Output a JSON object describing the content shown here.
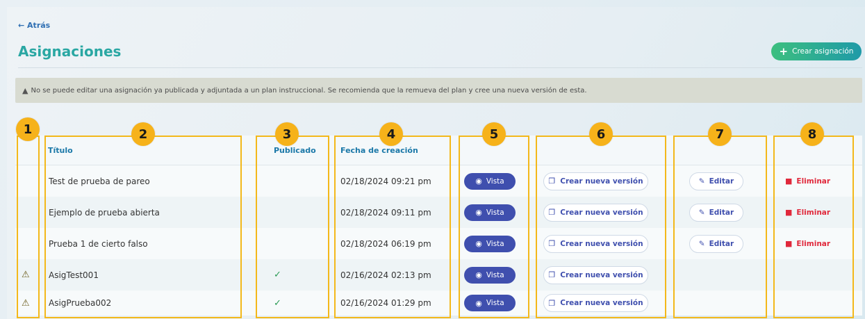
{
  "nav": {
    "back_label": "← Atrás"
  },
  "header": {
    "title": "Asignaciones",
    "create_button_label": "Crear asignación"
  },
  "notice": {
    "icon": "warning-icon",
    "text": "No se puede editar una asignación ya publicada y adjuntada a un plan instruccional. Se recomienda que la remueva del plan y cree una nueva versión de esta."
  },
  "table": {
    "columns": {
      "title": "Título",
      "published": "Publicado",
      "created": "Fecha de creación"
    },
    "rows": [
      {
        "warning": "",
        "title": "Test de prueba de pareo",
        "published": "",
        "created": "02/18/2024 09:21 pm",
        "view": "Vista",
        "new_version": "Crear nueva versión",
        "edit": "Editar",
        "delete": "Eliminar"
      },
      {
        "warning": "",
        "title": "Ejemplo de prueba abierta",
        "published": "",
        "created": "02/18/2024 09:11 pm",
        "view": "Vista",
        "new_version": "Crear nueva versión",
        "edit": "Editar",
        "delete": "Eliminar"
      },
      {
        "warning": "",
        "title": "Prueba 1 de cierto falso",
        "published": "",
        "created": "02/18/2024 06:19 pm",
        "view": "Vista",
        "new_version": "Crear nueva versión",
        "edit": "Editar",
        "delete": "Eliminar"
      },
      {
        "warning": "⚠",
        "title": "AsigTest001",
        "published": "✓",
        "created": "02/16/2024 02:13 pm",
        "view": "Vista",
        "new_version": "Crear nueva versión",
        "edit": "",
        "delete": ""
      },
      {
        "warning": "⚠",
        "title": "AsigPrueba002",
        "published": "✓",
        "created": "02/16/2024 01:29 pm",
        "view": "Vista",
        "new_version": "Crear nueva versión",
        "edit": "",
        "delete": ""
      }
    ]
  },
  "annotations": [
    "1",
    "2",
    "3",
    "4",
    "5",
    "6",
    "7",
    "8"
  ],
  "colors": {
    "accent_teal": "#2aa7a3",
    "link_blue": "#2f6fb3",
    "primary_indigo": "#3f4fae",
    "danger": "#e0283b",
    "annotation": "#f3b81a"
  }
}
